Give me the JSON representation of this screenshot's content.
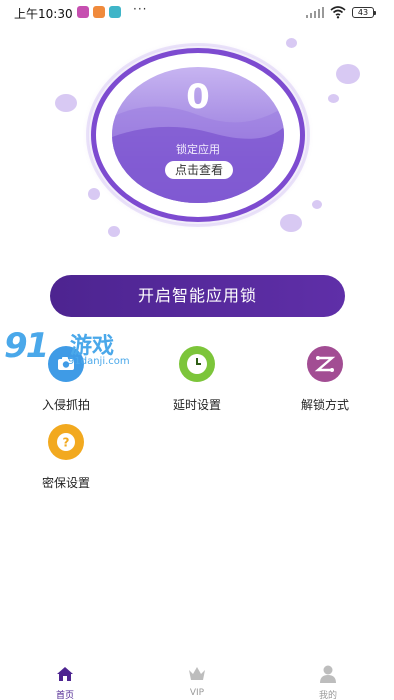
{
  "status_bar": {
    "time": "上午10:30",
    "dots": "···",
    "battery": "43"
  },
  "hero": {
    "count": "0",
    "label": "锁定应用",
    "button": "点击查看"
  },
  "main_button": "开启智能应用锁",
  "watermark": {
    "number": "91",
    "title": "游戏",
    "site": "91danji.com"
  },
  "features": [
    {
      "label": "入侵抓拍",
      "icon": "camera-icon",
      "color": "#3f9be6"
    },
    {
      "label": "延时设置",
      "icon": "clock-icon",
      "color": "#7cc53a"
    },
    {
      "label": "解锁方式",
      "icon": "pattern-lock-icon",
      "color": "#a24d93"
    },
    {
      "label": "密保设置",
      "icon": "question-icon",
      "color": "#f2a91f"
    }
  ],
  "bottom_nav": [
    {
      "label": "首页",
      "icon": "home-icon",
      "active": true
    },
    {
      "label": "VIP",
      "icon": "crown-icon",
      "active": false
    },
    {
      "label": "我的",
      "icon": "user-icon",
      "active": false
    }
  ],
  "colors": {
    "accent": "#4d2490",
    "ring": "#7d4bd0",
    "bubble": "#d8c9f3"
  }
}
